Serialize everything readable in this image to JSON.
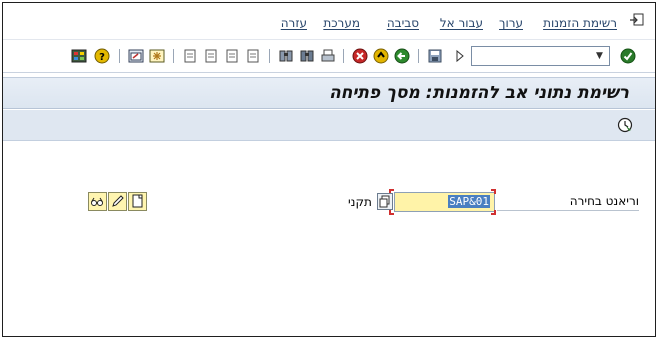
{
  "menu": {
    "items": [
      {
        "key": "list",
        "label": "רשימת הזמנות"
      },
      {
        "key": "edit",
        "label": "ערוך"
      },
      {
        "key": "goto",
        "label": "עבור אל"
      },
      {
        "key": "environment",
        "label": "סביבה"
      },
      {
        "key": "system",
        "label": "מערכת"
      },
      {
        "key": "help",
        "label": "עזרה"
      }
    ]
  },
  "toolbar": {
    "command_field_value": "",
    "icons": [
      "enter-icon",
      "save-icon",
      "back-icon",
      "exit-icon",
      "cancel-icon",
      "print-icon",
      "find-icon",
      "find-next-icon",
      "first-page-icon",
      "prev-page-icon",
      "next-page-icon",
      "last-page-icon",
      "new-session-icon",
      "shortcut-icon",
      "help-icon",
      "layout-icon"
    ]
  },
  "title": {
    "text": "רשימת נתוני אב להזמנות: מסך פתיחה"
  },
  "form": {
    "variant_label": "וריאנט בחירה",
    "variant_value": "SAP&01",
    "standard_label": "תקני"
  },
  "colors": {
    "menu_text": "#28456b",
    "title_bar": "#dce5f0",
    "app_toolbar": "#dfe7f1",
    "input_required_bg": "#fff3a8",
    "selection": "#4a7fc1"
  }
}
